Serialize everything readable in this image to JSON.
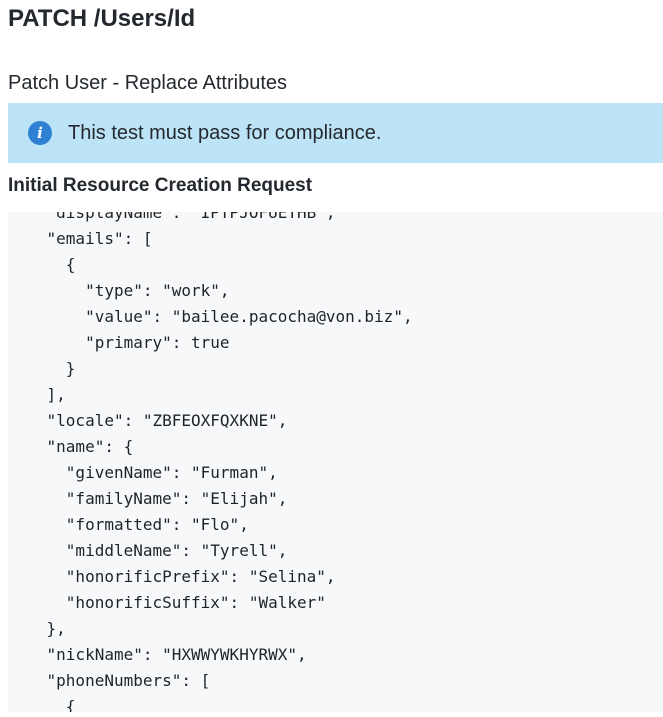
{
  "page": {
    "title": "PATCH /Users/Id",
    "subtitle": "Patch User - Replace Attributes"
  },
  "info_banner": {
    "icon": "info-icon",
    "icon_glyph": "i",
    "text": "This test must pass for compliance.",
    "background_color": "#bde3f7",
    "icon_color": "#2f7fd3"
  },
  "section": {
    "heading": "Initial Resource Creation Request"
  },
  "code": {
    "lines": [
      "    \"displayName\": \"IPTPJOFUETHB\",",
      "    \"emails\": [",
      "      {",
      "        \"type\": \"work\",",
      "        \"value\": \"bailee.pacocha@von.biz\",",
      "        \"primary\": true",
      "      }",
      "    ],",
      "    \"locale\": \"ZBFEOXFQXKNE\",",
      "    \"name\": {",
      "      \"givenName\": \"Furman\",",
      "      \"familyName\": \"Elijah\",",
      "      \"formatted\": \"Flo\",",
      "      \"middleName\": \"Tyrell\",",
      "      \"honorificPrefix\": \"Selina\",",
      "      \"honorificSuffix\": \"Walker\"",
      "    },",
      "    \"nickName\": \"HXWWYWKHYRWX\",",
      "    \"phoneNumbers\": [",
      "      {"
    ]
  }
}
